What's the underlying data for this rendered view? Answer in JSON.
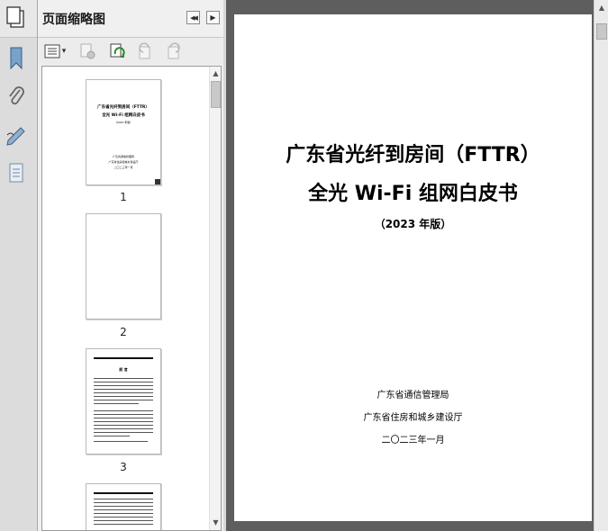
{
  "panel": {
    "title": "页面缩略图",
    "nav_prev_glyph": "◀◀",
    "nav_next_glyph": "▶",
    "options_arrow": "▾"
  },
  "rail": {
    "icons": [
      "pages-icon",
      "bookmark-icon",
      "attachment-icon",
      "signature-icon",
      "layers-icon"
    ]
  },
  "thumbnails": [
    {
      "label": "1",
      "title_lines": [
        "广东省光纤到房间（FTTR）",
        "全光 Wi-Fi 组网白皮书",
        "（2023 年版）"
      ],
      "org_lines": [
        "广东省通信管理局",
        "广东省住房和城乡建设厅",
        "二〇二三年一月"
      ]
    },
    {
      "label": "2"
    },
    {
      "label": "3",
      "heading": "前 言"
    },
    {
      "label": ""
    }
  ],
  "scroll": {
    "up_glyph": "▲",
    "down_glyph": "▼"
  },
  "document": {
    "title_line1": "广东省光纤到房间（FTTR）",
    "title_line2": "全光 Wi-Fi 组网白皮书",
    "edition": "（2023 年版）",
    "org1": "广东省通信管理局",
    "org2": "广东省住房和城乡建设厅",
    "date": "二〇二三年一月"
  }
}
